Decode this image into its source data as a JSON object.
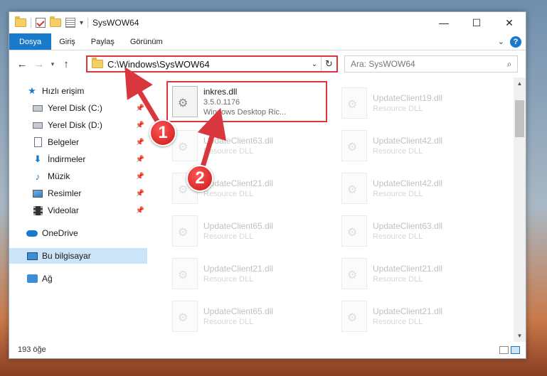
{
  "window": {
    "title": "SysWOW64",
    "controls": {
      "minimize": "—",
      "maximize": "☐",
      "close": "✕"
    }
  },
  "ribbon": {
    "tabs": [
      "Dosya",
      "Giriş",
      "Paylaş",
      "Görünüm"
    ],
    "help": "?"
  },
  "navigation": {
    "back": "←",
    "forward": "→",
    "recent": "▾",
    "up": "↑",
    "address": "C:\\Windows\\SysWOW64",
    "refresh": "↻",
    "search_placeholder": "Ara: SysWOW64"
  },
  "sidebar": {
    "items": [
      {
        "label": "Hızlı erişim",
        "icon": "star-icon",
        "pinned": false
      },
      {
        "label": "Yerel Disk (C:)",
        "icon": "drive-icon",
        "pinned": true
      },
      {
        "label": "Yerel Disk (D:)",
        "icon": "drive-icon",
        "pinned": true
      },
      {
        "label": "Belgeler",
        "icon": "document-icon",
        "pinned": true
      },
      {
        "label": "İndirmeler",
        "icon": "download-icon",
        "pinned": true
      },
      {
        "label": "Müzik",
        "icon": "music-icon",
        "pinned": true
      },
      {
        "label": "Resimler",
        "icon": "pictures-icon",
        "pinned": true
      },
      {
        "label": "Videolar",
        "icon": "video-icon",
        "pinned": true
      },
      {
        "label": "OneDrive",
        "icon": "cloud-icon",
        "pinned": false
      },
      {
        "label": "Bu bilgisayar",
        "icon": "computer-icon",
        "pinned": false,
        "selected": true
      },
      {
        "label": "Ağ",
        "icon": "network-icon",
        "pinned": false
      }
    ]
  },
  "files": {
    "highlighted": {
      "name": "inkres.dll",
      "version": "3.5.0.1176",
      "description": "Windows Desktop Ric..."
    },
    "left_column": [
      {
        "name": "UpdateClient63.dll",
        "type": "Resource DLL"
      },
      {
        "name": "UpdateClient21.dll",
        "type": "Resource DLL"
      },
      {
        "name": "UpdateClient65.dll",
        "type": "Resource DLL"
      },
      {
        "name": "UpdateClient21.dll",
        "type": "Resource DLL"
      },
      {
        "name": "UpdateClient65.dll",
        "type": "Resource DLL"
      }
    ],
    "right_column": [
      {
        "name": "UpdateClient19.dll",
        "type": "Resource DLL"
      },
      {
        "name": "UpdateClient42.dll",
        "type": "Resource DLL"
      },
      {
        "name": "UpdateClient42.dll",
        "type": "Resource DLL"
      },
      {
        "name": "UpdateClient63.dll",
        "type": "Resource DLL"
      },
      {
        "name": "UpdateClient21.dll",
        "type": "Resource DLL"
      },
      {
        "name": "UpdateClient21.dll",
        "type": "Resource DLL"
      }
    ]
  },
  "status": {
    "count": "193 öğe"
  },
  "annotations": {
    "step1": "1",
    "step2": "2",
    "color": "#d9363e"
  }
}
